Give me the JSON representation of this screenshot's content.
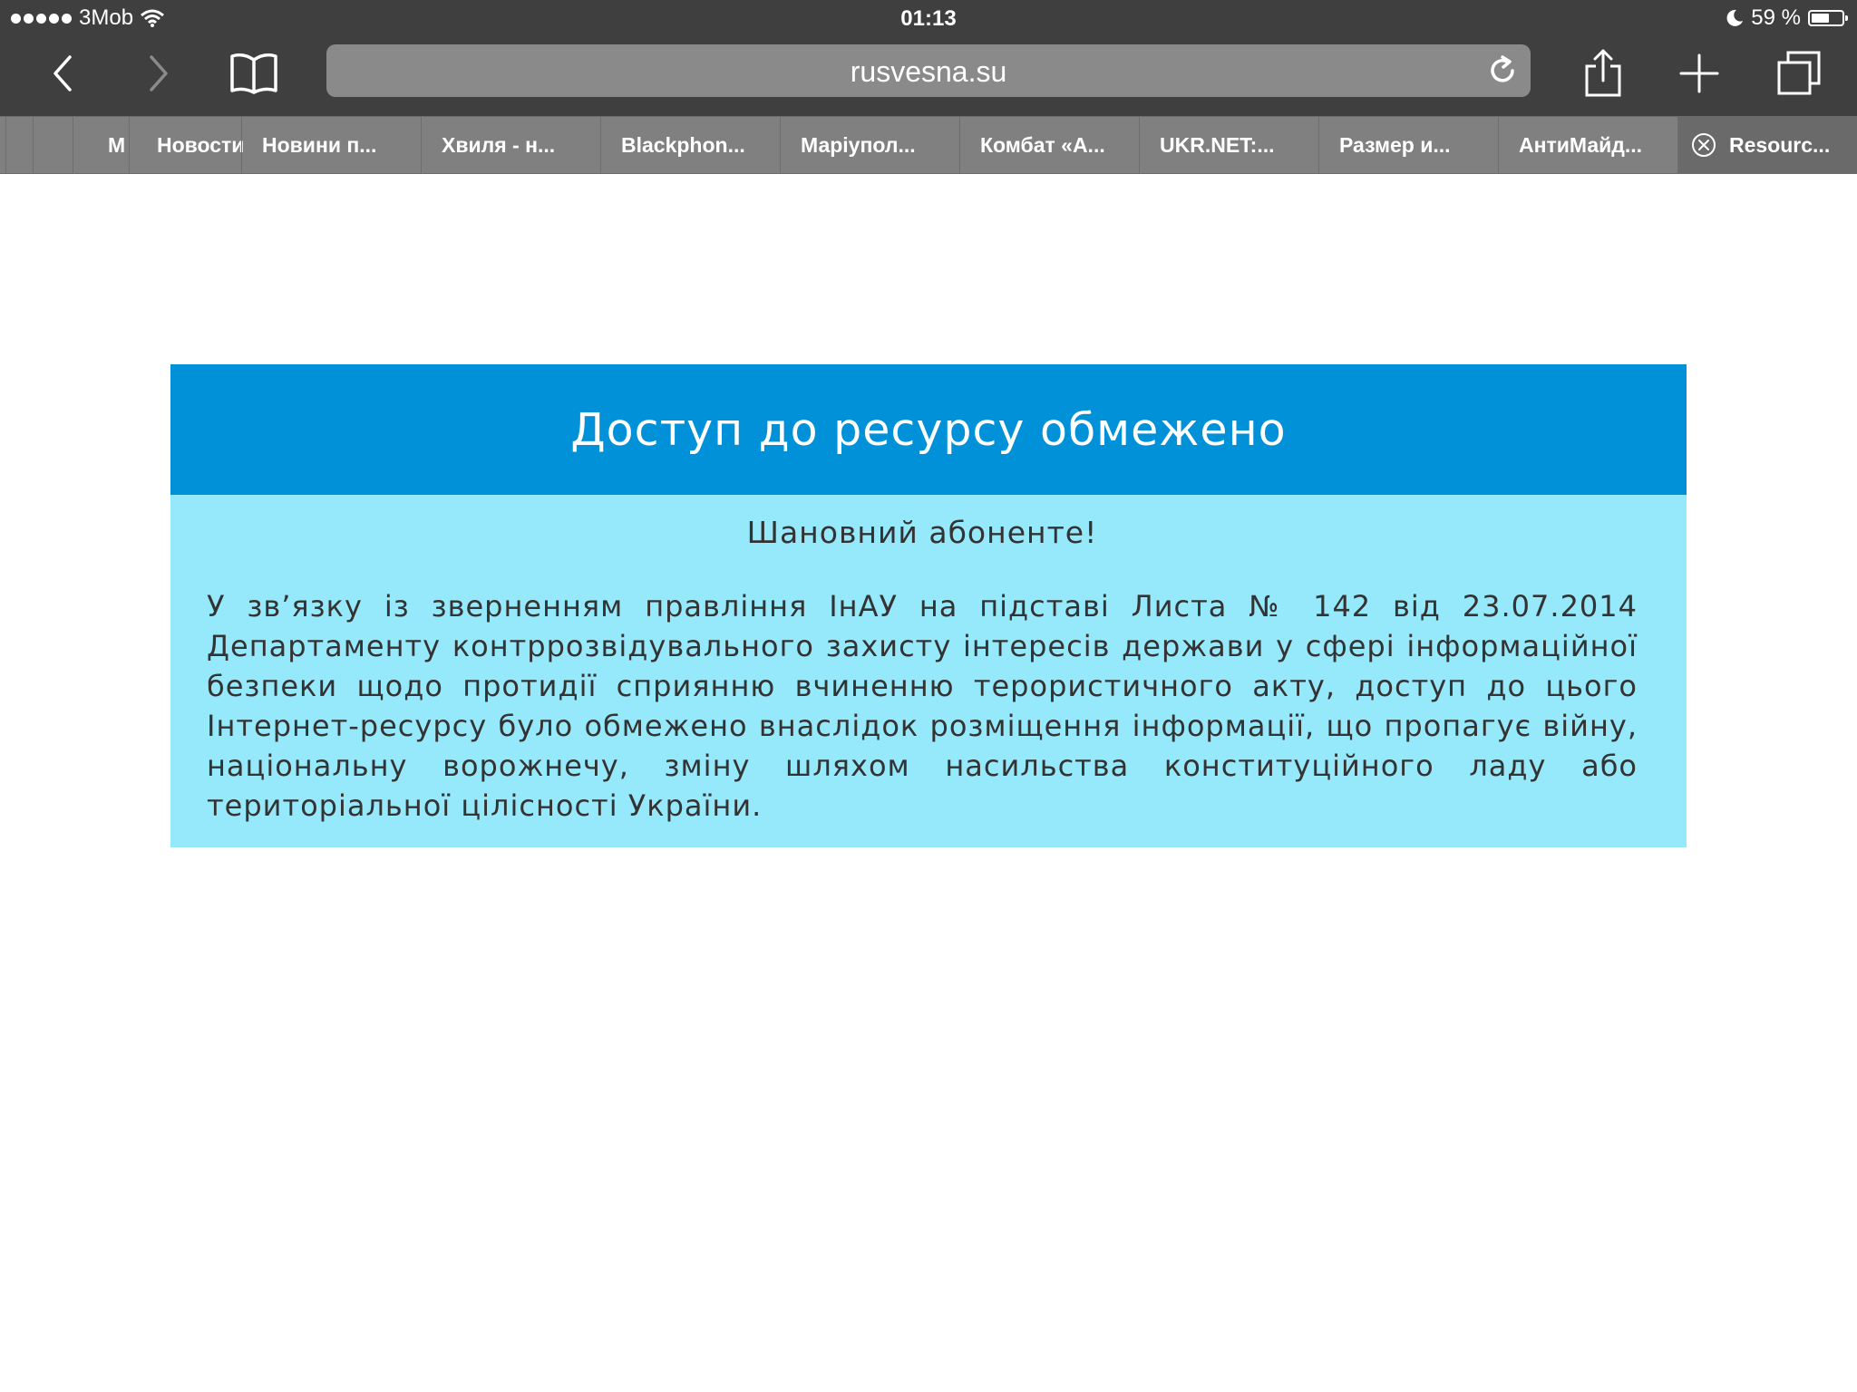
{
  "status_bar": {
    "carrier": "3Mob",
    "time": "01:13",
    "battery_text": "59 %",
    "battery_level": 0.59
  },
  "toolbar": {
    "url": "rusvesna.su",
    "icons": [
      "back-icon",
      "forward-icon",
      "bookmarks-icon",
      "reload-icon",
      "share-icon",
      "new-tab-icon",
      "tabs-icon"
    ]
  },
  "tabs": [
    {
      "label": "М"
    },
    {
      "label": "Новости"
    },
    {
      "label": "Новини п..."
    },
    {
      "label": "Хвиля - н..."
    },
    {
      "label": "Blackphon..."
    },
    {
      "label": "Маріупол..."
    },
    {
      "label": "Комбат «А..."
    },
    {
      "label": "UKR.NET:..."
    },
    {
      "label": "Размер и..."
    },
    {
      "label": "АнтиМайд..."
    },
    {
      "label": "Resourc..."
    }
  ],
  "notice": {
    "title": "Доступ до ресурсу обмежено",
    "greeting": "Шановний абоненте!",
    "message": "У зв’язку із зверненням правління ІнАУ на підставі Листа № 142 від 23.07.2014 Департаменту контррозвідувального захисту інтересів держави у сфері інформаційної безпеки щодо протидії сприянню вчиненню терористичного акту, доступ до цього Інтернет-ресурсу було обмежено внаслідок розміщення інформації, що пропагує війну, національну ворожнечу, зміну шляхом насильства конституційного ладу або територіальної цілісності України."
  },
  "colors": {
    "chrome": "#3f3f3f",
    "tabs": "#808080",
    "notice_header": "#0091d8",
    "notice_body": "#96e8fb"
  }
}
